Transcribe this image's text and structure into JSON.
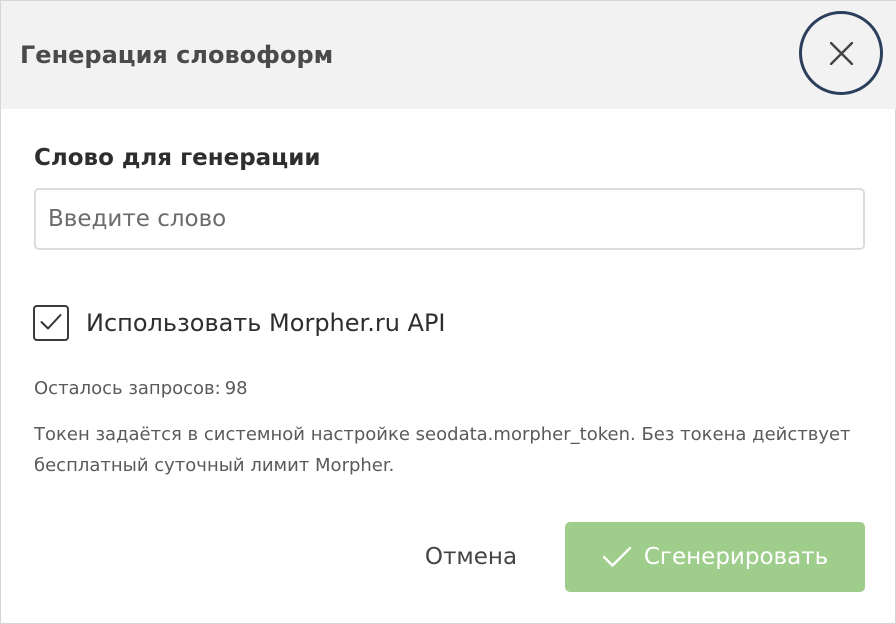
{
  "dialog": {
    "title": "Генерация словоформ",
    "close_icon": "close-icon"
  },
  "form": {
    "word_label": "Слово для генерации",
    "word_value": "",
    "word_placeholder": "Введите слово",
    "use_api_checked": true,
    "use_api_label": "Использовать Morpher.ru API",
    "remaining_label": "Осталось запросов:",
    "remaining_count": "98",
    "hint": "Токен задаётся в системной настройке seodata.morpher_token. Без токена действует бесплатный суточный лимит Morpher."
  },
  "footer": {
    "cancel_label": "Отмена",
    "generate_label": "Сгенерировать",
    "generate_icon": "check-icon"
  },
  "colors": {
    "header_bg": "#f2f2f2",
    "close_ring": "#2b3f5c",
    "generate_bg": "#9fce8c",
    "text": "#2e2e2e",
    "muted_text": "#5a5a5a"
  }
}
